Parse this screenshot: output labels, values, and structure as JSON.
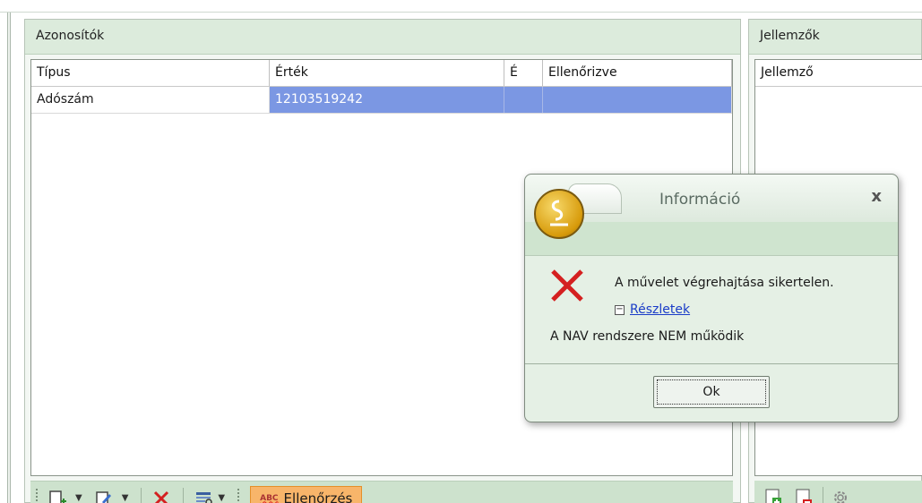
{
  "left_panel": {
    "title": "Azonosítók",
    "columns": [
      "Típus",
      "Érték",
      "É",
      "Ellenőrizve"
    ],
    "rows": [
      {
        "tipus": "Adószám",
        "ertek": "12103519242",
        "e": "",
        "ellenorizve": ""
      }
    ],
    "toolbar": {
      "check_label": "Ellenőrzés",
      "check_badge": "ABC"
    }
  },
  "right_panel": {
    "title": "Jellemzők",
    "columns": [
      "Jellemző"
    ]
  },
  "dialog": {
    "title": "Információ",
    "close_glyph": "x",
    "message": "A művelet végrehajtása sikertelen.",
    "details_toggle": "⊟",
    "details_link": "Részletek",
    "detail_text": "A NAV rendszere NEM működik",
    "ok_label": "Ok"
  },
  "colors": {
    "selection": "#7b97e3",
    "error_icon": "#d42020",
    "highlight_button": "#f8b56a"
  }
}
